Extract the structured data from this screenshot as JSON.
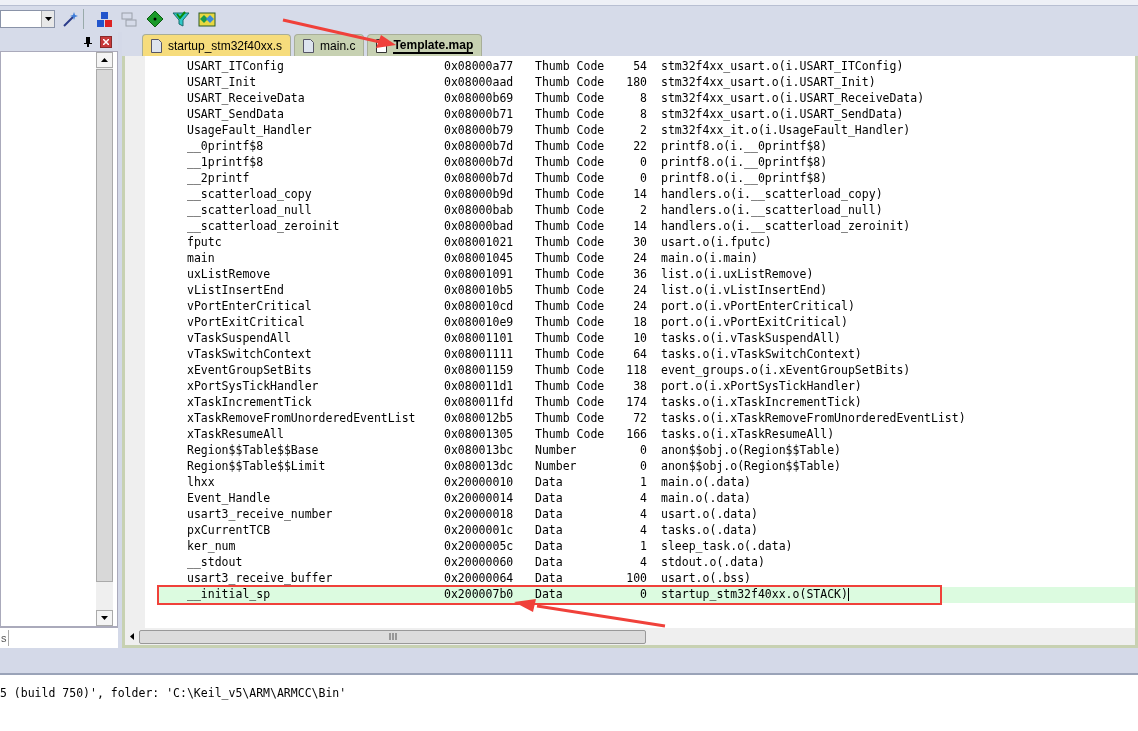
{
  "left_panel": {
    "bottom_tab": "s"
  },
  "tabs": [
    {
      "label": "startup_stm32f40xx.s",
      "kind": "asm",
      "selected": false
    },
    {
      "label": "main.c",
      "kind": "c",
      "selected": false
    },
    {
      "label": "Template.map",
      "kind": "map",
      "selected": true
    }
  ],
  "rows": [
    {
      "symbol": "USART_ITConfig",
      "address": "0x08000a77",
      "type": "Thumb Code",
      "size": "54",
      "object": "stm32f4xx_usart.o(i.USART_ITConfig)",
      "selected": false
    },
    {
      "symbol": "USART_Init",
      "address": "0x08000aad",
      "type": "Thumb Code",
      "size": "180",
      "object": "stm32f4xx_usart.o(i.USART_Init)",
      "selected": false
    },
    {
      "symbol": "USART_ReceiveData",
      "address": "0x08000b69",
      "type": "Thumb Code",
      "size": "8",
      "object": "stm32f4xx_usart.o(i.USART_ReceiveData)",
      "selected": false
    },
    {
      "symbol": "USART_SendData",
      "address": "0x08000b71",
      "type": "Thumb Code",
      "size": "8",
      "object": "stm32f4xx_usart.o(i.USART_SendData)",
      "selected": false
    },
    {
      "symbol": "UsageFault_Handler",
      "address": "0x08000b79",
      "type": "Thumb Code",
      "size": "2",
      "object": "stm32f4xx_it.o(i.UsageFault_Handler)",
      "selected": false
    },
    {
      "symbol": "__0printf$8",
      "address": "0x08000b7d",
      "type": "Thumb Code",
      "size": "22",
      "object": "printf8.o(i.__0printf$8)",
      "selected": false
    },
    {
      "symbol": "__1printf$8",
      "address": "0x08000b7d",
      "type": "Thumb Code",
      "size": "0",
      "object": "printf8.o(i.__0printf$8)",
      "selected": false
    },
    {
      "symbol": "__2printf",
      "address": "0x08000b7d",
      "type": "Thumb Code",
      "size": "0",
      "object": "printf8.o(i.__0printf$8)",
      "selected": false
    },
    {
      "symbol": "__scatterload_copy",
      "address": "0x08000b9d",
      "type": "Thumb Code",
      "size": "14",
      "object": "handlers.o(i.__scatterload_copy)",
      "selected": false
    },
    {
      "symbol": "__scatterload_null",
      "address": "0x08000bab",
      "type": "Thumb Code",
      "size": "2",
      "object": "handlers.o(i.__scatterload_null)",
      "selected": false
    },
    {
      "symbol": "__scatterload_zeroinit",
      "address": "0x08000bad",
      "type": "Thumb Code",
      "size": "14",
      "object": "handlers.o(i.__scatterload_zeroinit)",
      "selected": false
    },
    {
      "symbol": "fputc",
      "address": "0x08001021",
      "type": "Thumb Code",
      "size": "30",
      "object": "usart.o(i.fputc)",
      "selected": false
    },
    {
      "symbol": "main",
      "address": "0x08001045",
      "type": "Thumb Code",
      "size": "24",
      "object": "main.o(i.main)",
      "selected": false
    },
    {
      "symbol": "uxListRemove",
      "address": "0x08001091",
      "type": "Thumb Code",
      "size": "36",
      "object": "list.o(i.uxListRemove)",
      "selected": false
    },
    {
      "symbol": "vListInsertEnd",
      "address": "0x080010b5",
      "type": "Thumb Code",
      "size": "24",
      "object": "list.o(i.vListInsertEnd)",
      "selected": false
    },
    {
      "symbol": "vPortEnterCritical",
      "address": "0x080010cd",
      "type": "Thumb Code",
      "size": "24",
      "object": "port.o(i.vPortEnterCritical)",
      "selected": false
    },
    {
      "symbol": "vPortExitCritical",
      "address": "0x080010e9",
      "type": "Thumb Code",
      "size": "18",
      "object": "port.o(i.vPortExitCritical)",
      "selected": false
    },
    {
      "symbol": "vTaskSuspendAll",
      "address": "0x08001101",
      "type": "Thumb Code",
      "size": "10",
      "object": "tasks.o(i.vTaskSuspendAll)",
      "selected": false
    },
    {
      "symbol": "vTaskSwitchContext",
      "address": "0x08001111",
      "type": "Thumb Code",
      "size": "64",
      "object": "tasks.o(i.vTaskSwitchContext)",
      "selected": false
    },
    {
      "symbol": "xEventGroupSetBits",
      "address": "0x08001159",
      "type": "Thumb Code",
      "size": "118",
      "object": "event_groups.o(i.xEventGroupSetBits)",
      "selected": false
    },
    {
      "symbol": "xPortSysTickHandler",
      "address": "0x080011d1",
      "type": "Thumb Code",
      "size": "38",
      "object": "port.o(i.xPortSysTickHandler)",
      "selected": false
    },
    {
      "symbol": "xTaskIncrementTick",
      "address": "0x080011fd",
      "type": "Thumb Code",
      "size": "174",
      "object": "tasks.o(i.xTaskIncrementTick)",
      "selected": false
    },
    {
      "symbol": "xTaskRemoveFromUnorderedEventList",
      "address": "0x080012b5",
      "type": "Thumb Code",
      "size": "72",
      "object": "tasks.o(i.xTaskRemoveFromUnorderedEventList)",
      "selected": false
    },
    {
      "symbol": "xTaskResumeAll",
      "address": "0x08001305",
      "type": "Thumb Code",
      "size": "166",
      "object": "tasks.o(i.xTaskResumeAll)",
      "selected": false
    },
    {
      "symbol": "Region$$Table$$Base",
      "address": "0x080013bc",
      "type": "Number",
      "size": "0",
      "object": "anon$$obj.o(Region$$Table)",
      "selected": false
    },
    {
      "symbol": "Region$$Table$$Limit",
      "address": "0x080013dc",
      "type": "Number",
      "size": "0",
      "object": "anon$$obj.o(Region$$Table)",
      "selected": false
    },
    {
      "symbol": "lhxx",
      "address": "0x20000010",
      "type": "Data",
      "size": "1",
      "object": "main.o(.data)",
      "selected": false
    },
    {
      "symbol": "Event_Handle",
      "address": "0x20000014",
      "type": "Data",
      "size": "4",
      "object": "main.o(.data)",
      "selected": false
    },
    {
      "symbol": "usart3_receive_number",
      "address": "0x20000018",
      "type": "Data",
      "size": "4",
      "object": "usart.o(.data)",
      "selected": false
    },
    {
      "symbol": "pxCurrentTCB",
      "address": "0x2000001c",
      "type": "Data",
      "size": "4",
      "object": "tasks.o(.data)",
      "selected": false
    },
    {
      "symbol": "ker_num",
      "address": "0x2000005c",
      "type": "Data",
      "size": "1",
      "object": "sleep_task.o(.data)",
      "selected": false
    },
    {
      "symbol": "__stdout",
      "address": "0x20000060",
      "type": "Data",
      "size": "4",
      "object": "stdout.o(.data)",
      "selected": false
    },
    {
      "symbol": "usart3_receive_buffer",
      "address": "0x20000064",
      "type": "Data",
      "size": "100",
      "object": "usart.o(.bss)",
      "selected": false
    },
    {
      "symbol": "__initial_sp",
      "address": "0x200007b0",
      "type": "Data",
      "size": "0",
      "object": "startup_stm32f40xx.o(STACK)",
      "selected": true
    }
  ],
  "output": {
    "line": "5 (build 750)', folder: 'C:\\Keil_v5\\ARM\\ARMCC\\Bin'"
  }
}
